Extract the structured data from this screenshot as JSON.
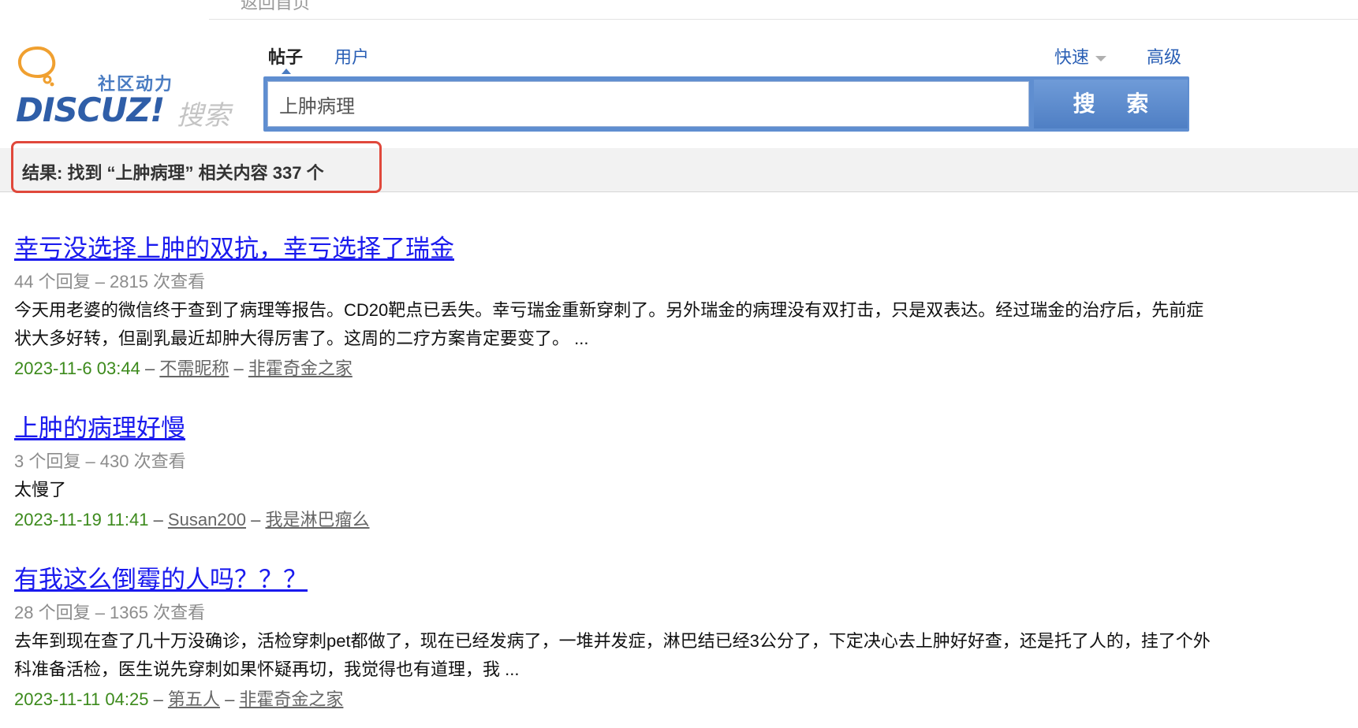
{
  "topbar": {
    "back_label": "返回首页"
  },
  "logo": {
    "cn_text": "社区动力",
    "brand_text": "DISCUZ!",
    "sub_text": "搜索"
  },
  "tabs": {
    "posts": "帖子",
    "users": "用户"
  },
  "quick_label": "快速",
  "advanced_label": "高级",
  "search": {
    "value": "上肿病理",
    "button_label": "搜 索"
  },
  "result_summary": "结果: 找到 “上肿病理” 相关内容 337 个",
  "colors": {
    "accent": "#5f8ed0",
    "link": "#1a1aee",
    "date": "#3c8a1c",
    "highlight": "#e0483b"
  },
  "results": [
    {
      "title": "幸亏没选择上肿的双抗，幸亏选择了瑞金",
      "meta": "44 个回复 – 2815 次查看",
      "body": "今天用老婆的微信终于查到了病理等报告。CD20靶点已丢失。幸亏瑞金重新穿刺了。另外瑞金的病理没有双打击，只是双表达。经过瑞金的治疗后，先前症状大多好转，但副乳最近却肿大得厉害了。这周的二疗方案肯定要变了。 ...",
      "date": "2023-11-6 03:44",
      "author": "不需昵称",
      "forum": "非霍奇金之家"
    },
    {
      "title": "上肿的病理好慢",
      "meta": "3 个回复 – 430 次查看",
      "body": "太慢了",
      "date": "2023-11-19 11:41",
      "author": "Susan200",
      "forum": "我是淋巴瘤么"
    },
    {
      "title": "有我这么倒霉的人吗？？？",
      "meta": "28 个回复 – 1365 次查看",
      "body": "去年到现在查了几十万没确诊，活检穿刺pet都做了，现在已经发病了，一堆并发症，淋巴结已经3公分了，下定决心去上肿好好查，还是托了人的，挂了个外科准备活检，医生说先穿刺如果怀疑再切，我觉得也有道理，我 ...",
      "date": "2023-11-11 04:25",
      "author": "第五人",
      "forum": "非霍奇金之家"
    }
  ]
}
